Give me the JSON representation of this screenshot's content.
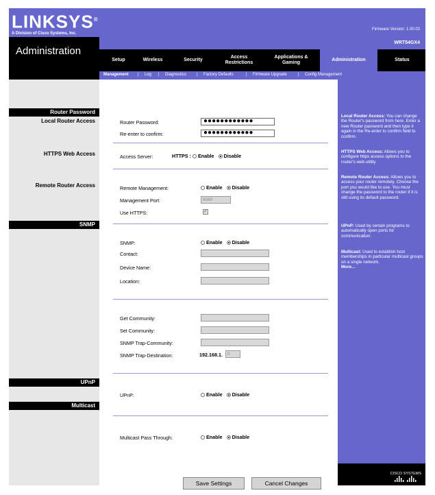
{
  "brand": {
    "name": "LINKSYS",
    "registered": "®",
    "tagline": "A Division of Cisco Systems, Inc."
  },
  "firmware": "Firmware Version: 1.00.03",
  "model": "WRT54GX4",
  "section_title": "Administration",
  "tabs": [
    {
      "label": "Setup"
    },
    {
      "label": "Wireless"
    },
    {
      "label": "Security"
    },
    {
      "label": "Access Restrictions"
    },
    {
      "label": "Applications & Gaming"
    },
    {
      "label": "Administration"
    },
    {
      "label": "Status"
    }
  ],
  "subtabs": [
    "Management",
    "Log",
    "Diagnostics",
    "Factory Defaults",
    "Firmware Upgrade",
    "Config Management"
  ],
  "sidebar": {
    "router_password": "Router Password",
    "local_router_access": "Local Router Access",
    "https_web_access": "HTTPS Web Access",
    "remote_router_access": "Remote Router Access",
    "snmp": "SNMP",
    "upnp": "UPnP",
    "multicast": "Multicast"
  },
  "form": {
    "router_password_label": "Router Password:",
    "router_password_value": "●●●●●●●●●●●●",
    "reenter_label": "Re-enter to confirm:",
    "reenter_value": "●●●●●●●●●●●●",
    "access_server_label": "Access Server:",
    "https_label": "HTTPS :",
    "enable": "Enable",
    "disable": "Disable",
    "remote_mgmt_label": "Remote Management:",
    "mgmt_port_label": "Management Port:",
    "mgmt_port_value": "8080",
    "use_https_label": "Use HTTPS:",
    "snmp_label": "SNMP:",
    "contact_label": "Contact:",
    "device_name_label": "Device Name:",
    "location_label": "Location:",
    "get_community_label": "Get Community:",
    "set_community_label": "Set Community:",
    "trap_community_label": "SNMP Trap-Community:",
    "trap_destination_label": "SNMP Trap-Destination:",
    "trap_destination_prefix": "192.168.1.",
    "trap_destination_value": "0",
    "upnp_label": "UPnP:",
    "multicast_label": "Multicast Pass Through:"
  },
  "help": {
    "local_title": "Local Router Access:",
    "local_text": "You can change the Router's password from here. Enter a new Router password and then type it again in the Re-enter to confirm field to confirm.",
    "https_title": "HTTPS Web Access:",
    "https_text": "Allows you to configure https access options to the router's web utility.",
    "remote_title": "Remote Router Access:",
    "remote_text": "Allows you to access your router remotely. Choose the port you would like to use. You must change the password to the router if it is still using its default password.",
    "upnp_title": "UPnP:",
    "upnp_text": "Used by certain programs to automatically open ports for communication.",
    "multicast_title": "Multicast:",
    "multicast_text": "Used to establish host memberships in particular multicast groups on a single network.",
    "more": "More..."
  },
  "buttons": {
    "save": "Save Settings",
    "cancel": "Cancel Changes"
  },
  "cisco": {
    "name": "CISCO SYSTEMS"
  }
}
